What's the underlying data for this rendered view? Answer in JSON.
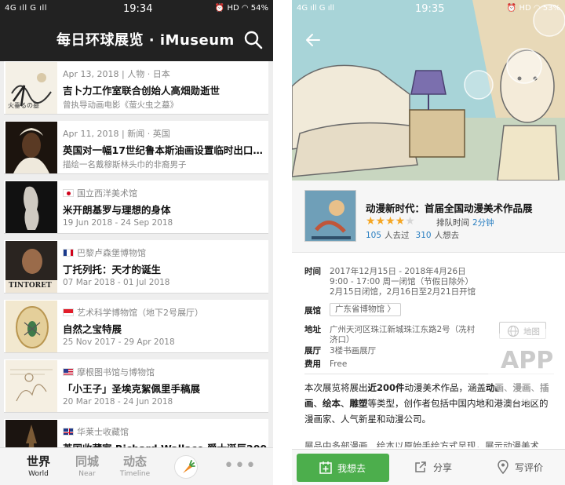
{
  "left": {
    "status": {
      "signal": "4G ıll  G ıll",
      "time": "19:34",
      "right": "⏰ HD ◠ 54%"
    },
    "title": "每日环球展览 · iMuseum",
    "cards": [
      {
        "meta": "Apr 13, 2018 | 人物 · 日本",
        "headline": "吉卜力工作室联合创始人高畑勋逝世",
        "sub": "曾执导动画电影《萤火虫之墓》",
        "thumb_text": "火垂るの墓"
      },
      {
        "meta": "Apr 11, 2018 | 新闻 · 英国",
        "headline": "英国对一幅17世纪鲁本斯油画设置临时出口…",
        "sub": "描绘一名戴穆斯林头巾的非裔男子"
      },
      {
        "meta": "国立西洋美术馆",
        "headline": "米开朗基罗与理想的身体",
        "sub": "19 Jun 2018 - 24 Sep 2018",
        "flag": "jp"
      },
      {
        "meta": "巴黎卢森堡博物馆",
        "headline": "丁托列托：天才的诞生",
        "sub": "07 Mar 2018 - 01 Jul 2018",
        "flag": "fr",
        "thumb_text": "TINTORET"
      },
      {
        "meta": "艺术科学博物馆（地下2号展厅）",
        "headline": "自然之宝特展",
        "sub": "25 Nov 2017 - 29 Apr 2018",
        "flag": "sg"
      },
      {
        "meta": "摩根图书馆与博物馆",
        "headline": "「小王子」圣埃克絮佩里手稿展",
        "sub": "20 Mar 2018 - 24 Jun 2018",
        "flag": "us"
      },
      {
        "meta": "华莱士收藏馆",
        "headline": "英国收藏家 Richard Wallace 爵士诞辰200…",
        "sub": "",
        "flag": "gb"
      }
    ],
    "tabs": [
      {
        "big": "世界",
        "small": "World"
      },
      {
        "big": "同城",
        "small": "Near"
      },
      {
        "big": "动态",
        "small": "Timeline"
      }
    ],
    "more": "•••"
  },
  "right": {
    "status": {
      "signal": "4G ıll  G ıll",
      "time": "19:35",
      "right": "⏰ HD ◠ 53%"
    },
    "exhibit": {
      "title": "动漫新时代：首届全国动漫美术作品展",
      "rating": 4,
      "rating_max": 5,
      "queue_label": "排队时间",
      "queue_value": "2分钟",
      "been_count": "105",
      "been_label": "人去过",
      "want_count": "310",
      "want_label": "人想去"
    },
    "info": {
      "time_label": "时间",
      "time_lines": [
        "2017年12月15日 - 2018年4月26日",
        "9:00 - 17:00  周一闭馆（节假日除外）",
        "2月15日闭馆，2月16日至2月21日开馆"
      ],
      "venue_label": "展馆",
      "venue": "广东省博物馆 〉",
      "address_label": "地址",
      "address": "广州天河区珠江新城珠江东路2号（冼村济口）",
      "hall_label": "展厅",
      "hall": "3楼书画展厅",
      "fee_label": "费用",
      "fee": "Free",
      "map_label": "地图"
    },
    "description": {
      "p1_a": "本次展览将展出",
      "p1_b": "近200件",
      "p1_c": "动漫美术作品，涵盖",
      "p1_d": "动画",
      "p1_e": "、",
      "p1_f": "漫画",
      "p1_g": "、",
      "p1_h": "插画",
      "p1_i": "、",
      "p1_j": "绘本",
      "p1_k": "、",
      "p1_l": "雕塑",
      "p1_m": "等类型，创作者包括中国内地和港澳台地区的漫画家、人气新星和动漫公司。",
      "p2": "展品中多部漫画、绘本以原始手绘方式呈现，展示动漫美术"
    },
    "watermark": "APP",
    "actions": {
      "want": "我想去",
      "share": "分享",
      "review": "写评价"
    }
  }
}
